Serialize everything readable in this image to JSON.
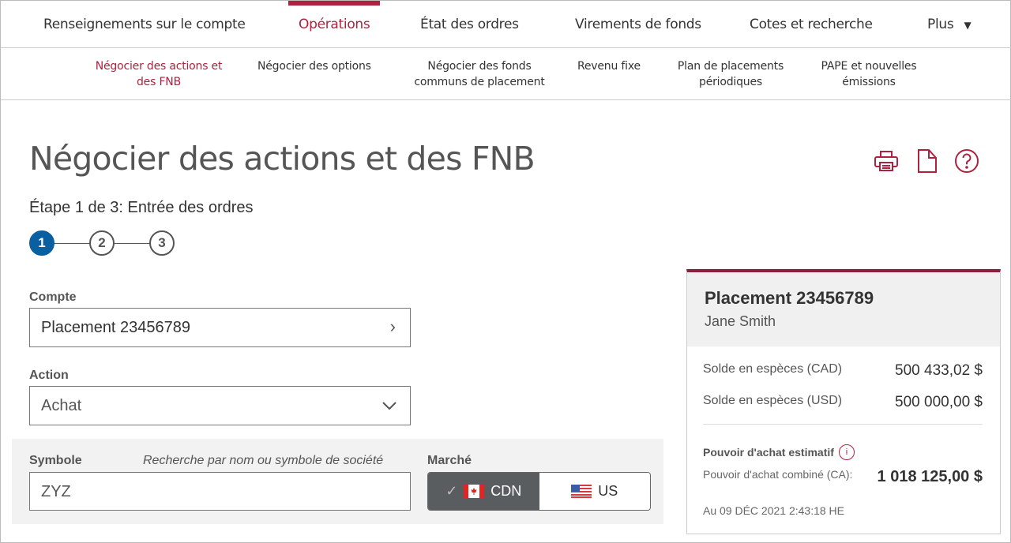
{
  "topnav": {
    "items": [
      "Renseignements sur le compte",
      "Opérations",
      "État des ordres",
      "Virements de fonds",
      "Cotes et recherche",
      "Plus"
    ],
    "active": 1
  },
  "subnav": {
    "items": [
      "Négocier des actions et des FNB",
      "Négocier des options",
      "Négocier des fonds communs de placement",
      "Revenu fixe",
      "Plan de placements périodiques",
      "PAPE et nouvelles émissions"
    ]
  },
  "page": {
    "title": "Négocier des actions et des FNB",
    "step_label": "Étape 1 de 3: Entrée des ordres",
    "steps": [
      "1",
      "2",
      "3"
    ],
    "current_step": 1,
    "icons": [
      "printer-icon",
      "document-icon",
      "help-icon"
    ]
  },
  "form": {
    "account_label": "Compte",
    "account_value": "Placement 23456789",
    "action_label": "Action",
    "action_value": "Achat",
    "symbol_label": "Symbole",
    "symbol_hint": "Recherche par nom ou symbole de société",
    "symbol_value": "ZYZ",
    "market_label": "Marché",
    "market_options": [
      "CDN",
      "US"
    ],
    "market_selected": "CDN"
  },
  "summary": {
    "title": "Placement 23456789",
    "owner": "Jane Smith",
    "cad_label": "Solde en espèces (CAD)",
    "cad_value": "500 433,02 $",
    "usd_label": "Solde en espèces (USD)",
    "usd_value": "500 000,00 $",
    "bp_title": "Pouvoir d'achat estimatif",
    "bp_label": "Pouvoir d'achat combiné (CA):",
    "bp_value": "1 018 125,00 $",
    "as_of": "Au 09 DÉC 2021 2:43:18 HE"
  },
  "colors": {
    "accent": "#b0213d",
    "step_active": "#0a5fa0",
    "card_border": "#8a1e3c"
  }
}
